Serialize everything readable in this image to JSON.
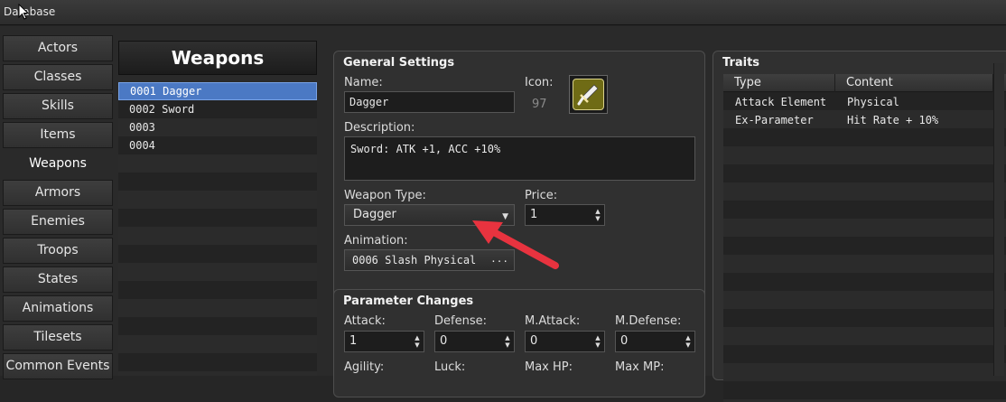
{
  "window": {
    "title": "Database"
  },
  "tabs": [
    "Actors",
    "Classes",
    "Skills",
    "Items",
    "Weapons",
    "Armors",
    "Enemies",
    "Troops",
    "States",
    "Animations",
    "Tilesets",
    "Common Events"
  ],
  "list": {
    "title": "Weapons",
    "items": [
      "0001 Dagger",
      "0002 Sword",
      "0003",
      "0004"
    ],
    "selected_index": 0
  },
  "general": {
    "title": "General Settings",
    "name_label": "Name:",
    "name_value": "Dagger",
    "icon_label": "Icon:",
    "icon_index": "97",
    "icon_name": "dagger-icon",
    "description_label": "Description:",
    "description_value": "Sword: ATK +1, ACC +10%",
    "weapon_type_label": "Weapon Type:",
    "weapon_type_value": "Dagger",
    "price_label": "Price:",
    "price_value": "1",
    "animation_label": "Animation:",
    "animation_value": "0006 Slash Physical",
    "animation_button": "..."
  },
  "params": {
    "title": "Parameter Changes",
    "fields": [
      {
        "label": "Attack:",
        "value": "1"
      },
      {
        "label": "Defense:",
        "value": "0"
      },
      {
        "label": "M.Attack:",
        "value": "0"
      },
      {
        "label": "M.Defense:",
        "value": "0"
      }
    ],
    "row2_labels": [
      "Agility:",
      "Luck:",
      "Max HP:",
      "Max MP:"
    ]
  },
  "traits": {
    "title": "Traits",
    "columns": [
      "Type",
      "Content"
    ],
    "rows": [
      {
        "type": "Attack Element",
        "content": "Physical"
      },
      {
        "type": "Ex-Parameter",
        "content": "Hit Rate + 10%"
      }
    ]
  },
  "colors": {
    "selection": "#4b79c4",
    "annotation_arrow": "#e8333f",
    "icon_bg": "#6f6b15"
  }
}
